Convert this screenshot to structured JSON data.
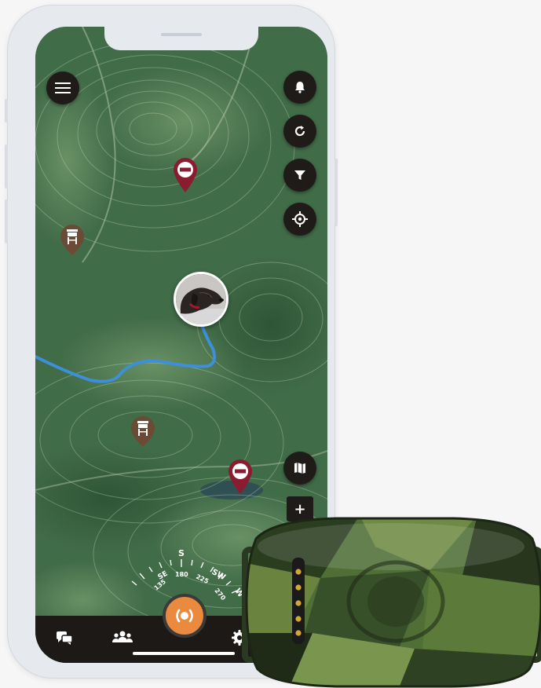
{
  "controls": {
    "menu_icon": "hamburger-menu-icon",
    "alert_icon": "bell-icon",
    "refresh_icon": "refresh-icon",
    "filter_icon": "filter-icon",
    "locate_icon": "crosshair-icon",
    "map_layers_icon": "map-icon",
    "zoom_in_label": "+"
  },
  "compass": {
    "labels": [
      "SE",
      "S",
      "SW",
      "W"
    ],
    "degrees": [
      "135",
      "180",
      "225",
      "270"
    ],
    "center_label": "(●)"
  },
  "tabbar": {
    "items": [
      {
        "icon": "chat-icon"
      },
      {
        "icon": "group-icon"
      },
      {
        "icon": "settings-icon"
      }
    ]
  },
  "colors": {
    "map_green": "#3f6b47",
    "track_blue": "#3d8fd8",
    "pin_red": "#8a1c2f",
    "stand_brown": "#6b4a36",
    "accent_orange": "#e98a3f",
    "control_dark": "#1f1b19"
  }
}
